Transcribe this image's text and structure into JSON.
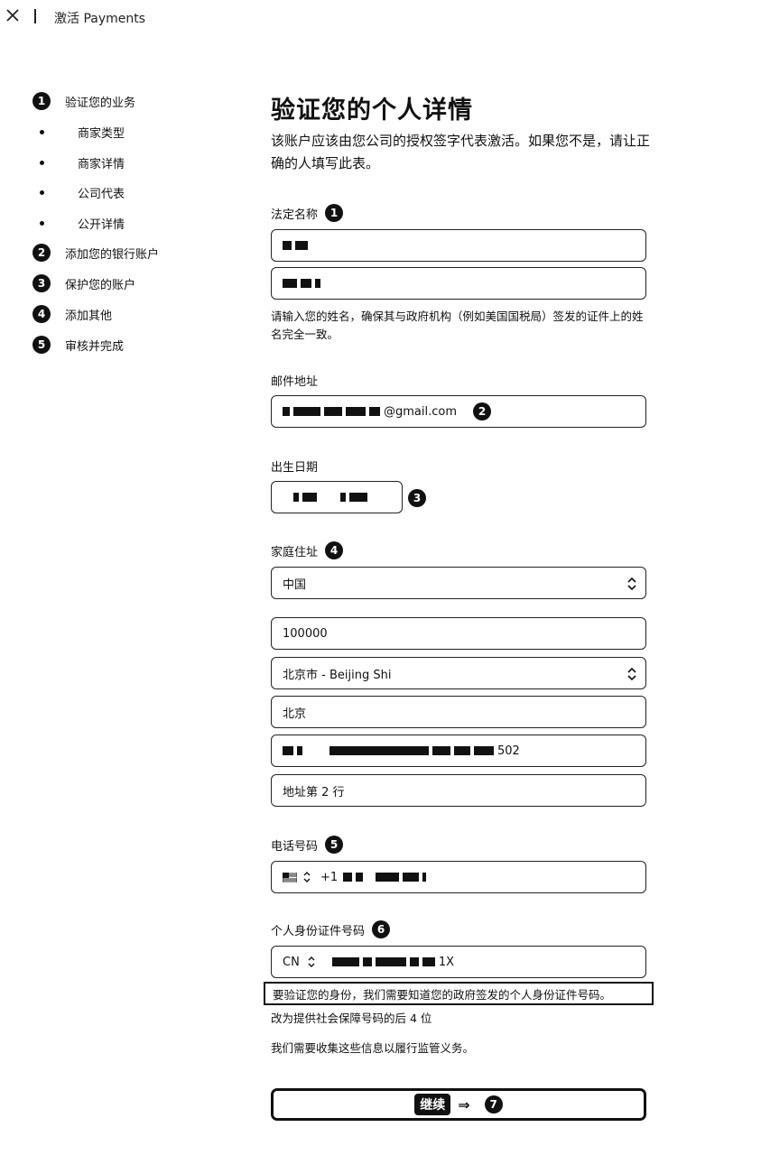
{
  "window": {
    "title": "激活 Payments"
  },
  "sidebar": {
    "steps": [
      {
        "num": "1",
        "label": "验证您的业务"
      },
      {
        "num": "2",
        "label": "添加您的银行账户"
      },
      {
        "num": "3",
        "label": "保护您的账户"
      },
      {
        "num": "4",
        "label": "添加其他"
      },
      {
        "num": "5",
        "label": "审核并完成"
      }
    ],
    "substeps": [
      "商家类型",
      "商家详情",
      "公司代表",
      "公开详情"
    ]
  },
  "main": {
    "title": "验证您的个人详情",
    "description": "该账户应该由您公司的授权签字代表激活。如果您不是，请让正确的人填写此表。",
    "legal_name": {
      "label": "法定名称",
      "badge": "1",
      "hint": "请输入您的姓名，确保其与政府机构（例如美国国税局）签发的证件上的姓名完全一致。"
    },
    "email": {
      "label": "邮件地址",
      "value_suffix": "@gmail.com",
      "badge": "2"
    },
    "dob": {
      "label": "出生日期",
      "badge": "3"
    },
    "address": {
      "label": "家庭住址",
      "badge": "4",
      "country": "中国",
      "postal_code": "100000",
      "province": "北京市 - Beijing Shi",
      "city": "北京",
      "line1_suffix": "502",
      "line2_placeholder": "地址第 2 行"
    },
    "phone": {
      "label": "电话号码",
      "badge": "5",
      "prefix": "+1"
    },
    "id_number": {
      "label": "个人身份证件号码",
      "badge": "6",
      "country": "CN",
      "value_suffix": "1X",
      "hint_highlight": "要验证您的身份，我们需要知道您的政府签发的个人身份证件号码。",
      "alt_link": "改为提供社会保障号码的后 4 位",
      "compliance": "我们需要收集这些信息以履行监管义务。"
    },
    "continue": {
      "label": "继续",
      "arrow": "⇒",
      "badge": "7"
    }
  }
}
